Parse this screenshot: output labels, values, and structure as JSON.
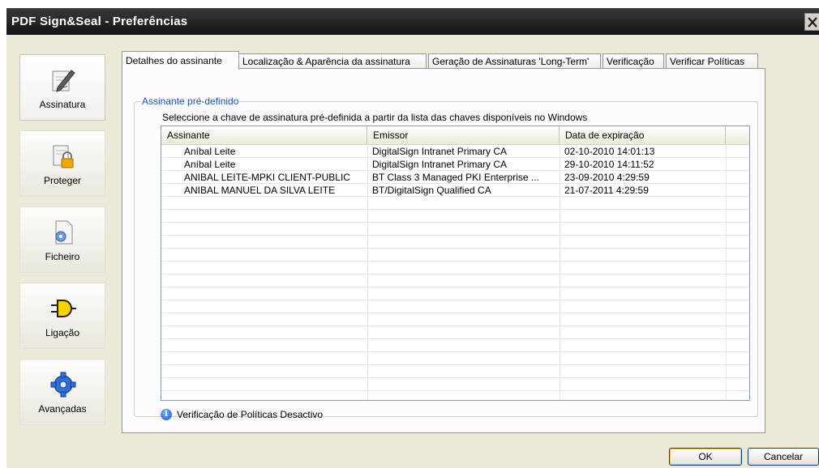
{
  "window": {
    "title": "PDF Sign&Seal - Preferências"
  },
  "sidebar": {
    "items": [
      {
        "label": "Assinatura",
        "icon": "pen-paper-icon"
      },
      {
        "label": "Proteger",
        "icon": "lock-document-icon"
      },
      {
        "label": "Ficheiro",
        "icon": "file-gear-icon"
      },
      {
        "label": "Ligação",
        "icon": "plug-icon"
      },
      {
        "label": "Avançadas",
        "icon": "gear-icon"
      }
    ]
  },
  "tabs": [
    {
      "label": "Detalhes do assinante"
    },
    {
      "label": "Localização & Aparência da assinatura"
    },
    {
      "label": "Geração de Assinaturas 'Long-Term'"
    },
    {
      "label": "Verificação"
    },
    {
      "label": "Verificar Políticas"
    }
  ],
  "group": {
    "title": "Assinante pré-definido",
    "instruction": "Seleccione a chave de assinatura pré-definida a partir da lista das chaves disponíveis no Windows"
  },
  "table": {
    "columns": [
      "Assinante",
      "Emissor",
      "Data de expiração"
    ],
    "rows": [
      [
        "Aníbal Leite",
        "DigitalSign Intranet Primary CA",
        "02-10-2010 14:01:13"
      ],
      [
        "Aníbal Leite",
        "DigitalSign Intranet Primary CA",
        "29-10-2010 14:11:52"
      ],
      [
        "ANIBAL LEITE-MPKI CLIENT-PUBLIC",
        "BT Class 3 Managed PKI Enterprise ...",
        "23-09-2010 4:29:59"
      ],
      [
        "ANIBAL MANUEL DA SILVA LEITE",
        "BT/DigitalSign Qualified CA",
        "21-07-2011 4:29:59"
      ]
    ]
  },
  "status": {
    "text": "Verificação de Políticas Desactivo"
  },
  "buttons": {
    "ok": "OK",
    "cancel": "Cancelar"
  },
  "colors": {
    "titlebar": "#1e1e1e",
    "group_title": "#1c4fb5",
    "window_bg": "#ece9d8"
  }
}
